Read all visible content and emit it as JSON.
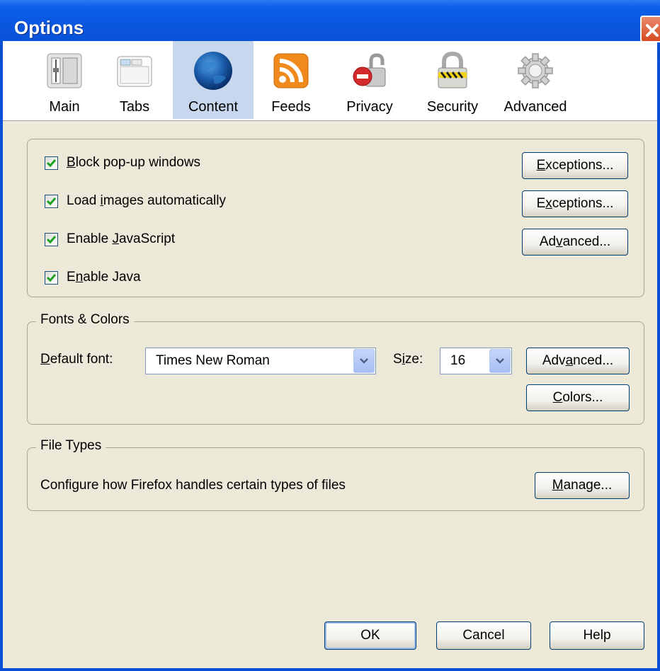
{
  "window": {
    "title": "Options"
  },
  "toolbar": {
    "items": [
      {
        "label": "Main",
        "icon": "main-switch-icon"
      },
      {
        "label": "Tabs",
        "icon": "tabs-window-icon"
      },
      {
        "label": "Content",
        "icon": "globe-icon",
        "selected": true
      },
      {
        "label": "Feeds",
        "icon": "rss-feed-icon"
      },
      {
        "label": "Privacy",
        "icon": "privacy-lock-icon"
      },
      {
        "label": "Security",
        "icon": "security-padlock-icon"
      },
      {
        "label": "Advanced",
        "icon": "gear-icon"
      }
    ]
  },
  "content": {
    "checkboxes": [
      {
        "pre": "",
        "key": "B",
        "post": "lock pop-up windows",
        "checked": true
      },
      {
        "pre": "Load ",
        "key": "i",
        "post": "mages automatically",
        "checked": true
      },
      {
        "pre": "Enable ",
        "key": "J",
        "post": "avaScript",
        "checked": true
      },
      {
        "pre": "E",
        "key": "n",
        "post": "able Java",
        "checked": true
      }
    ],
    "buttons": {
      "exceptions_popup": {
        "pre": "",
        "key": "E",
        "post": "xceptions..."
      },
      "exceptions_images": {
        "pre": "E",
        "key": "x",
        "post": "ceptions..."
      },
      "advanced_js": {
        "pre": "Ad",
        "key": "v",
        "post": "anced..."
      }
    }
  },
  "fonts_colors": {
    "legend": "Fonts & Colors",
    "default_font_label": {
      "pre": "",
      "key": "D",
      "post": "efault font:"
    },
    "default_font_value": "Times New Roman",
    "size_label": {
      "pre": "S",
      "key": "i",
      "post": "ze:"
    },
    "size_value": "16",
    "advanced_button": {
      "pre": "Adv",
      "key": "a",
      "post": "nced..."
    },
    "colors_button": {
      "pre": "",
      "key": "C",
      "post": "olors..."
    }
  },
  "file_types": {
    "legend": "File Types",
    "description": "Configure how Firefox handles certain types of files",
    "manage_button": {
      "pre": "",
      "key": "M",
      "post": "anage..."
    }
  },
  "footer": {
    "ok": "OK",
    "cancel": "Cancel",
    "help": "Help"
  },
  "colors": {
    "titlebar": "#0a57e0",
    "dialog_bg": "#ece9d8",
    "selected_tab": "#c7d8ee",
    "check_green": "#21a121"
  }
}
